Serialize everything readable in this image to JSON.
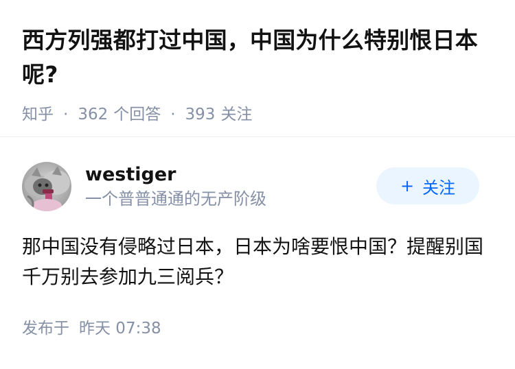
{
  "question": {
    "title": "西方列强都打过中国，中国为什么特别恨日本呢?",
    "source": "知乎",
    "answer_count": "362",
    "answer_label": "个回答",
    "follow_count": "393",
    "follow_label": "关注",
    "separator": "·"
  },
  "answer": {
    "author": {
      "name": "westiger",
      "bio": "一个普普通通的无产阶级",
      "avatar_icon": "cat-avatar-icon"
    },
    "follow_button": {
      "icon": "+",
      "label": "关注"
    },
    "content": "那中国没有侵略过日本，日本为啥要恨中国？提醒别国千万别去参加九三阅兵？",
    "published_label": "发布于",
    "published_time": "昨天 07:38"
  },
  "colors": {
    "text": "#121212",
    "meta": "#8590a6",
    "accent": "#0066ff",
    "button_bg": "#ebf5ff"
  }
}
